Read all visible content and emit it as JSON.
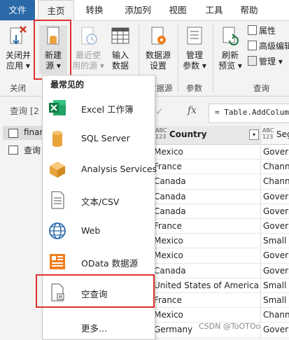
{
  "menubar": {
    "tabs": [
      "文件",
      "主页",
      "转换",
      "添加列",
      "视图",
      "工具",
      "帮助"
    ],
    "file_color": "#2b6aa9"
  },
  "ribbon": {
    "close": {
      "btn": "关闭并\n应用",
      "line1": "关闭并",
      "line2": "应用 ▾",
      "group": "关闭"
    },
    "new_source": {
      "line1": "新建",
      "line2": "源 ▾"
    },
    "recent_sources": {
      "line1": "最近使",
      "line2": "用的源 ▾"
    },
    "enter_data": {
      "line1": "输入",
      "line2": "数据"
    },
    "datasource_settings": {
      "line1": "数据源",
      "line2": "设置",
      "group": "数据源"
    },
    "manage_params": {
      "line1": "管理",
      "line2": "参数 ▾",
      "group": "参数"
    },
    "refresh_preview": {
      "line1": "刷新",
      "line2": "预览 ▾"
    },
    "properties": "属性",
    "advanced_editor": "高级编辑",
    "manage": "管理 ▾",
    "query_group": "查询"
  },
  "queries": {
    "title": "查询 [2",
    "items": [
      "finan",
      "查询"
    ]
  },
  "formula": {
    "text": "= Table.AddColum",
    "fx": "fx",
    "check": "✓"
  },
  "grid": {
    "col1": {
      "type": "ABC\n123",
      "type_top": "ABC",
      "type_bottom": "123",
      "name": "Country"
    },
    "col2": {
      "type_top": "ABC",
      "type_bottom": "123",
      "name": "Seg"
    },
    "rows": [
      [
        "Mexico",
        "Govern"
      ],
      [
        "France",
        "Channe"
      ],
      [
        "Canada",
        "Channe"
      ],
      [
        "Canada",
        "Govern"
      ],
      [
        "Canada",
        "Govern"
      ],
      [
        "France",
        "Govern"
      ],
      [
        "Mexico",
        "Small B"
      ],
      [
        "Mexico",
        "Govern"
      ],
      [
        "Canada",
        "Govern"
      ],
      [
        "United States of America",
        "Small B"
      ],
      [
        "France",
        "Small B"
      ],
      [
        "Mexico",
        "Channe"
      ],
      [
        "Germany",
        "Govern"
      ]
    ]
  },
  "dropdown": {
    "header": "最常见的",
    "items": [
      {
        "label": "Excel 工作簿",
        "icon": "excel-icon"
      },
      {
        "label": "SQL Server",
        "icon": "database-icon"
      },
      {
        "label": "Analysis Services",
        "icon": "cube-icon"
      },
      {
        "label": "文本/CSV",
        "icon": "text-file-icon"
      },
      {
        "label": "Web",
        "icon": "globe-icon"
      },
      {
        "label": "OData 数据源",
        "icon": "odata-icon"
      },
      {
        "label": "空查询",
        "icon": "blank-query-icon"
      }
    ],
    "more": "更多..."
  },
  "watermark": "CSDN @ToOTOo",
  "colors": {
    "highlight": "#e0332d",
    "excel": "#1d7a43",
    "accent": "#2b6aa9",
    "odata": "#f07e1b",
    "database": "#e8a33b"
  }
}
